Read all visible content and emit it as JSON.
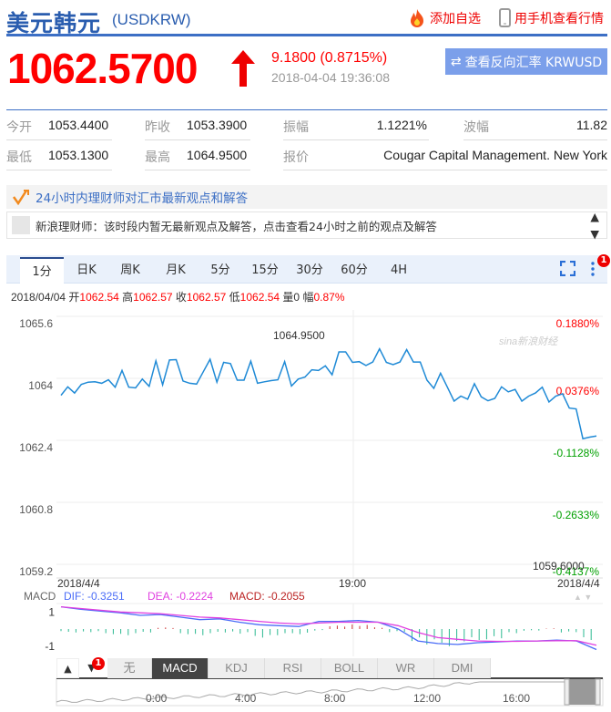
{
  "header": {
    "title": "美元韩元",
    "code": "(USDKRW)",
    "add_watchlist": "添加自选",
    "mobile_view": "用手机查看行情"
  },
  "quote": {
    "price": "1062.5700",
    "change": "9.1800 (0.8715%)",
    "time": "2018-04-04 19:36:08",
    "reverse_button": "查看反向汇率 KRWUSD"
  },
  "stats": [
    {
      "label": "今开",
      "value": "1053.4400"
    },
    {
      "label": "昨收",
      "value": "1053.3900"
    },
    {
      "label": "振幅",
      "value": "1.1221%"
    },
    {
      "label": "波幅",
      "value": "11.82"
    },
    {
      "label": "最低",
      "value": "1053.1300"
    },
    {
      "label": "最高",
      "value": "1064.9500"
    },
    {
      "label": "报价",
      "value": "Cougar Capital Management. New York"
    }
  ],
  "viewpoints": {
    "title": "24小时内理财师对汇市最新观点和解答",
    "message": "新浪理财师：该时段内暂无最新观点及解答，点击查看24小时之前的观点及解答"
  },
  "chart_tabs": [
    "1分",
    "日K",
    "周K",
    "月K",
    "5分",
    "15分",
    "30分",
    "60分",
    "4H"
  ],
  "chart_badge": "1",
  "ohlc": {
    "date": "2018/04/04",
    "open_label": "开",
    "open": "1062.54",
    "high_label": "高",
    "high": "1062.57",
    "close_label": "收",
    "close": "1062.57",
    "low_label": "低",
    "low": "1062.54",
    "vol_label": "量",
    "vol": "0",
    "amp_label": "幅",
    "amp": "0.87%"
  },
  "indicator_tabs": [
    "无",
    "MACD",
    "KDJ",
    "RSI",
    "BOLL",
    "WR",
    "DMI"
  ],
  "indicator_badge": "1",
  "macd_legend": {
    "label": "MACD",
    "dif": "DIF: -0.3251",
    "dea": "DEA: -0.2224",
    "macd": "MACD: -0.2055"
  },
  "colors": {
    "accent": "#3c6fc5",
    "up": "#ff0000",
    "down": "#00a000",
    "line": "#1f8ad6"
  },
  "watermark": "sina新浪财经",
  "chart_data": {
    "type": "line",
    "title": "USDKRW 1分",
    "ylim": [
      1059.2,
      1065.6
    ],
    "y_ticks": [
      "1065.6",
      "1064",
      "1062.4",
      "1060.8",
      "1059.2"
    ],
    "pct_ticks": [
      {
        "v": "0.1880%",
        "c": "up"
      },
      {
        "v": "0.0376%",
        "c": "up"
      },
      {
        "v": "-0.1128%",
        "c": "down"
      },
      {
        "v": "-0.2633%",
        "c": "down"
      },
      {
        "v": "-0.4137%",
        "c": "down"
      }
    ],
    "x_labels": [
      "2018/4/4",
      "19:00",
      "2018/4/4"
    ],
    "max_label": "1064.9500",
    "min_label": "1059.6000",
    "values": [
      1063.75,
      1063.97,
      1063.81,
      1064.03,
      1064.09,
      1064.1,
      1064.06,
      1064.15,
      1063.96,
      1064.39,
      1063.96,
      1063.94,
      1064.17,
      1063.98,
      1064.64,
      1064.02,
      1064.66,
      1064.67,
      1064.12,
      1064.06,
      1064.04,
      1064.36,
      1064.68,
      1064.09,
      1064.6,
      1064.57,
      1064.14,
      1064.14,
      1064.63,
      1064.06,
      1064.1,
      1064.13,
      1064.15,
      1064.62,
      1063.99,
      1064.17,
      1064.22,
      1064.41,
      1064.39,
      1064.51,
      1064.28,
      1064.87,
      1064.87,
      1064.6,
      1064.62,
      1064.52,
      1064.61,
      1064.95,
      1064.6,
      1064.54,
      1064.61,
      1064.93,
      1064.61,
      1064.61,
      1064.14,
      1063.93,
      1064.32,
      1063.96,
      1063.6,
      1063.73,
      1063.65,
      1064.05,
      1063.71,
      1063.61,
      1063.67,
      1063.97,
      1063.84,
      1063.9,
      1063.6,
      1063.73,
      1063.81,
      1063.96,
      1063.58,
      1063.73,
      1063.79,
      1063.42,
      1063.4,
      1062.63,
      1062.67,
      1062.7
    ],
    "macd": {
      "ylim": [
        -1.6,
        1.6
      ],
      "ticks": [
        "1",
        "-1"
      ],
      "dif": [
        1.3,
        1.15,
        1.05,
        0.95,
        0.8,
        0.85,
        0.7,
        0.55,
        0.6,
        0.4,
        0.25,
        0.2,
        0.15,
        0.45,
        0.45,
        0.5,
        0.4,
        0.0,
        -0.7,
        -0.85,
        -0.9,
        -0.8,
        -0.75,
        -0.7,
        -0.7,
        -0.65,
        -0.7,
        -1.2
      ],
      "dea": [
        1.3,
        1.2,
        1.1,
        1.0,
        0.95,
        0.9,
        0.8,
        0.7,
        0.65,
        0.55,
        0.45,
        0.35,
        0.3,
        0.35,
        0.4,
        0.4,
        0.4,
        0.2,
        -0.2,
        -0.5,
        -0.6,
        -0.7,
        -0.72,
        -0.72,
        -0.7,
        -0.68,
        -0.68,
        -0.95
      ],
      "hist": [
        -0.2,
        -0.2,
        -0.3,
        -0.4,
        -0.2,
        0.1,
        -0.3,
        -0.4,
        -0.2,
        -0.3,
        -0.5,
        -0.4,
        -0.3,
        -0.1,
        0.2,
        0.3,
        0.1,
        -0.2,
        -0.7,
        -1.0,
        -1.0,
        -0.8,
        -0.6,
        -0.3,
        -0.1,
        0.05,
        -0.2,
        -0.8
      ]
    },
    "navigator_labels": [
      "0:00",
      "4:00",
      "8:00",
      "12:00",
      "16:00"
    ]
  }
}
